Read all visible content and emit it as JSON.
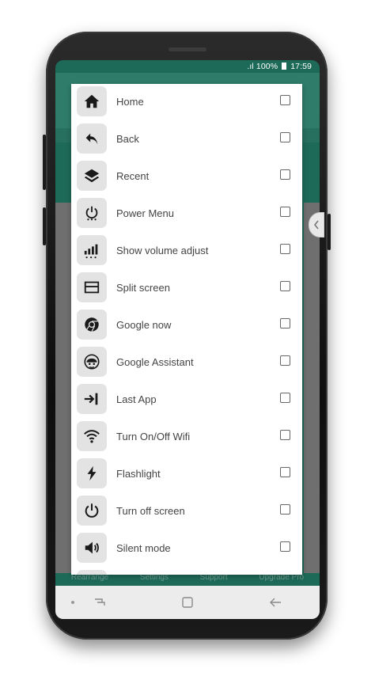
{
  "status": {
    "signal": ".ıl",
    "battery": "100%",
    "time": "17:59"
  },
  "items": [
    {
      "label": "Home",
      "icon": "home-icon",
      "checked": false
    },
    {
      "label": "Back",
      "icon": "back-arrow-icon",
      "checked": false
    },
    {
      "label": "Recent",
      "icon": "layers-icon",
      "checked": false
    },
    {
      "label": "Power Menu",
      "icon": "power-menu-icon",
      "checked": false
    },
    {
      "label": "Show volume adjust",
      "icon": "volume-adjust-icon",
      "checked": false
    },
    {
      "label": "Split screen",
      "icon": "split-screen-icon",
      "checked": false
    },
    {
      "label": "Google now",
      "icon": "chrome-icon",
      "checked": false
    },
    {
      "label": "Google Assistant",
      "icon": "assistant-icon",
      "checked": false
    },
    {
      "label": "Last App",
      "icon": "last-app-icon",
      "checked": false
    },
    {
      "label": "Turn On/Off Wifi",
      "icon": "wifi-icon",
      "checked": false
    },
    {
      "label": "Flashlight",
      "icon": "flashlight-icon",
      "checked": false
    },
    {
      "label": "Turn off screen",
      "icon": "power-icon",
      "checked": false
    },
    {
      "label": "Silent mode",
      "icon": "speaker-icon",
      "checked": false
    }
  ],
  "background_tabs": [
    "Rearrange",
    "Settings",
    "Support",
    "Upgrade Pro"
  ],
  "colors": {
    "accent": "#1e6a58",
    "icon_bg": "#e3e3e3",
    "text": "#444444"
  }
}
